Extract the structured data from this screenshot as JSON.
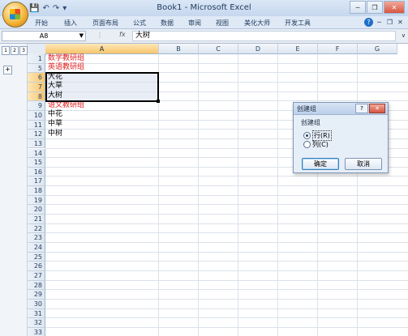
{
  "window": {
    "title": "Book1 - Microsoft Excel",
    "qat": [
      "save-icon",
      "undo-icon",
      "redo-icon",
      "customize-icon"
    ],
    "controls": [
      "minimize-icon",
      "restore-icon",
      "close-icon"
    ]
  },
  "ribbon": {
    "tabs": [
      "开始",
      "插入",
      "页面布局",
      "公式",
      "数据",
      "审阅",
      "视图",
      "美化大师",
      "开发工具"
    ]
  },
  "formula_bar": {
    "name_box": "A8",
    "fx": "fx",
    "value": "大树"
  },
  "outline": {
    "levels": [
      "1",
      "2",
      "3"
    ],
    "expand": "+"
  },
  "sheet": {
    "columns": [
      "A",
      "B",
      "C",
      "D",
      "E",
      "F",
      "G"
    ],
    "active_column": "A",
    "rows": [
      {
        "num": "1",
        "a": "数学教研组",
        "red": true
      },
      {
        "num": "5",
        "a": "英语教研组",
        "red": true
      },
      {
        "num": "6",
        "a": "大花",
        "red": false
      },
      {
        "num": "7",
        "a": "大草",
        "red": false
      },
      {
        "num": "8",
        "a": "大树",
        "red": false
      },
      {
        "num": "9",
        "a": "语文教研组",
        "red": true
      },
      {
        "num": "10",
        "a": "中花",
        "red": false
      },
      {
        "num": "11",
        "a": "中草",
        "red": false
      },
      {
        "num": "12",
        "a": "中树",
        "red": false
      },
      {
        "num": "13",
        "a": ""
      },
      {
        "num": "14",
        "a": ""
      },
      {
        "num": "15",
        "a": ""
      },
      {
        "num": "16",
        "a": ""
      },
      {
        "num": "17",
        "a": ""
      },
      {
        "num": "18",
        "a": ""
      },
      {
        "num": "19",
        "a": ""
      },
      {
        "num": "20",
        "a": ""
      },
      {
        "num": "21",
        "a": ""
      },
      {
        "num": "22",
        "a": ""
      },
      {
        "num": "23",
        "a": ""
      },
      {
        "num": "24",
        "a": ""
      },
      {
        "num": "25",
        "a": ""
      },
      {
        "num": "26",
        "a": ""
      },
      {
        "num": "27",
        "a": ""
      },
      {
        "num": "28",
        "a": ""
      },
      {
        "num": "29",
        "a": ""
      },
      {
        "num": "30",
        "a": ""
      },
      {
        "num": "31",
        "a": ""
      },
      {
        "num": "32",
        "a": ""
      },
      {
        "num": "33",
        "a": ""
      }
    ],
    "selected_rows": [
      "6",
      "7",
      "8"
    ]
  },
  "dialog": {
    "title": "创建组",
    "help": "?",
    "close": "✕",
    "group_label": "创建组",
    "options": [
      {
        "label": "行(R)",
        "checked": true
      },
      {
        "label": "列(C)",
        "checked": false
      }
    ],
    "ok": "确定",
    "cancel": "取消"
  },
  "colors": {
    "accent": "#f7c56a",
    "red_text": "#e02020",
    "selection_border": "#000000"
  }
}
